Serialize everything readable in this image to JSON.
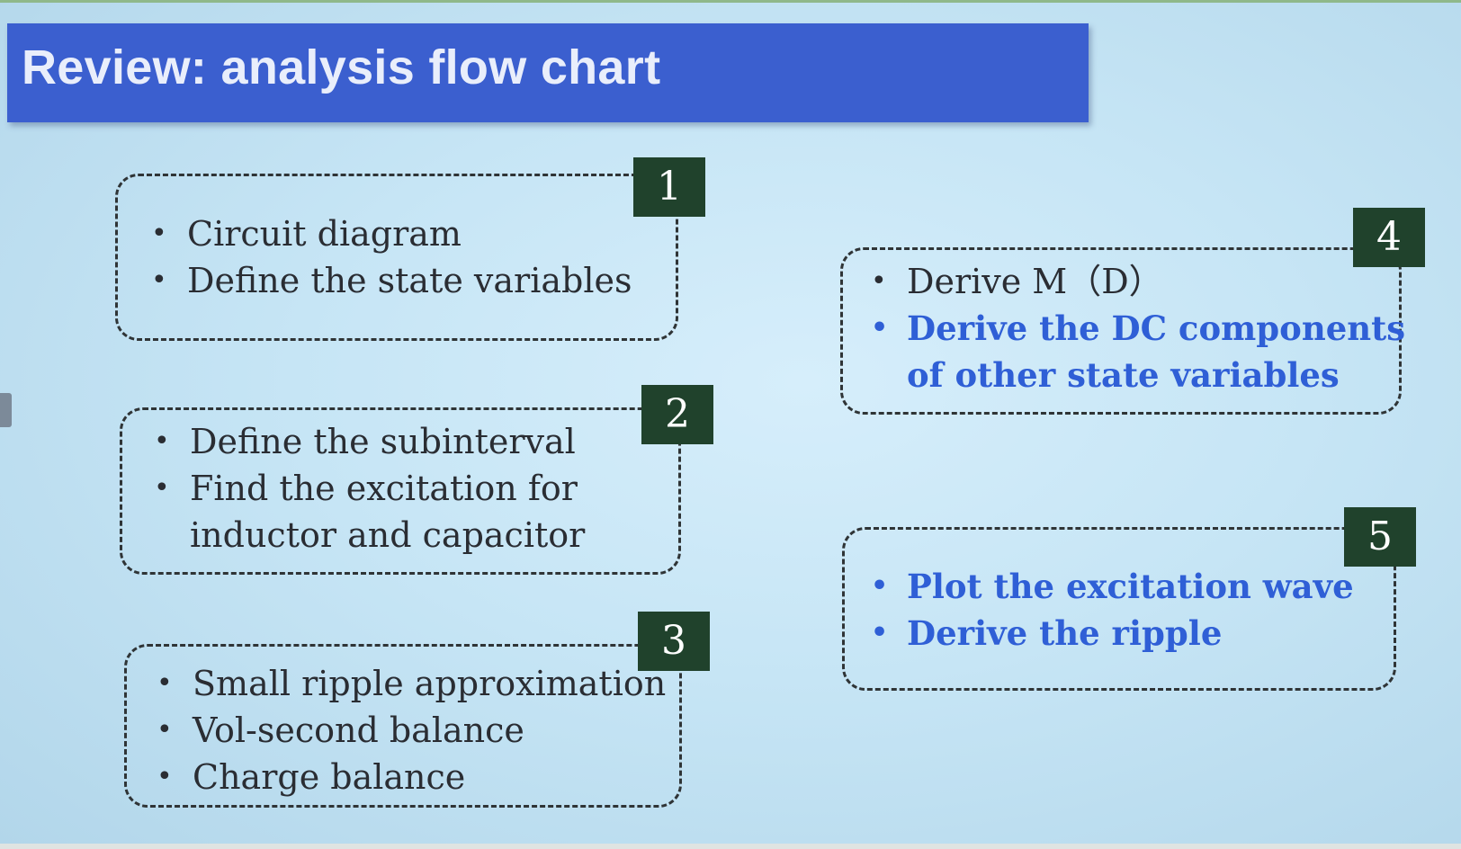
{
  "title": "Review: analysis flow chart",
  "accent_color": "#3b5fcf",
  "badge_color": "#20422c",
  "emphasis_color": "#2f5fd6",
  "steps": [
    {
      "number": "1",
      "items": [
        {
          "text": "Circuit diagram",
          "emphasis": false
        },
        {
          "text": "Define the state variables",
          "emphasis": false
        }
      ]
    },
    {
      "number": "2",
      "items": [
        {
          "text": "Define the subinterval",
          "emphasis": false
        },
        {
          "line1": "Find the excitation for",
          "line2": "inductor and capacitor",
          "emphasis": false
        }
      ]
    },
    {
      "number": "3",
      "items": [
        {
          "text": "Small ripple approximation",
          "emphasis": false
        },
        {
          "text": "Vol-second balance",
          "emphasis": false
        },
        {
          "text": "Charge balance",
          "emphasis": false
        }
      ]
    },
    {
      "number": "4",
      "items": [
        {
          "text": "Derive M（D）",
          "emphasis": false
        },
        {
          "line1": "Derive the DC components",
          "line2": "of other state variables",
          "emphasis": true
        }
      ]
    },
    {
      "number": "5",
      "items": [
        {
          "text": "Plot the excitation wave",
          "emphasis": true
        },
        {
          "text": "Derive the ripple",
          "emphasis": true
        }
      ]
    }
  ]
}
